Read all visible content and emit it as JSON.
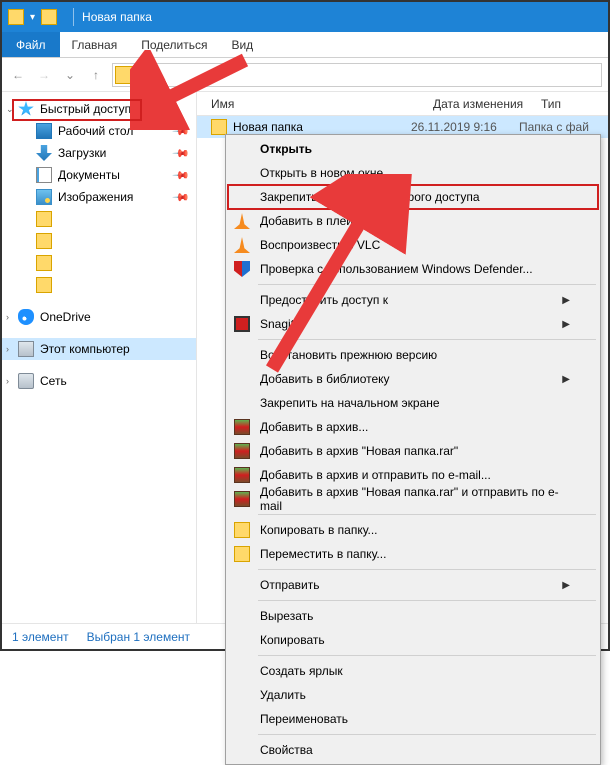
{
  "title": "Новая папка",
  "menubar": {
    "file": "Файл",
    "home": "Главная",
    "share": "Поделиться",
    "view": "Вид"
  },
  "breadcrumb": {
    "segments": []
  },
  "columns": {
    "name": "Имя",
    "date": "Дата изменения",
    "type": "Тип"
  },
  "sidebar": {
    "quick_access": "Быстрый доступ",
    "desktop": "Рабочий стол",
    "downloads": "Загрузки",
    "documents": "Документы",
    "pictures": "Изображения",
    "onedrive": "OneDrive",
    "this_pc": "Этот компьютер",
    "network": "Сеть"
  },
  "files": [
    {
      "name": "Новая папка",
      "date": "26.11.2019 9:16",
      "type": "Папка с фай"
    }
  ],
  "context_menu": {
    "open": "Открыть",
    "open_new": "Открыть в новом окне",
    "pin_quick": "Закрепить на панели быстрого доступа",
    "vlc_add": "Добавить в плейлист VLC",
    "vlc_play": "Воспроизвести в VLC",
    "defender": "Проверка с использованием Windows Defender...",
    "grant_access": "Предоставить доступ к",
    "snagit": "Snagit",
    "restore_prev": "Восстановить прежнюю версию",
    "add_library": "Добавить в библиотеку",
    "pin_start": "Закрепить на начальном экране",
    "rar_add": "Добавить в архив...",
    "rar_add_name": "Добавить в архив \"Новая папка.rar\"",
    "rar_email": "Добавить в архив и отправить по e-mail...",
    "rar_name_email": "Добавить в архив \"Новая папка.rar\" и отправить по e-mail",
    "copy_to": "Копировать в папку...",
    "move_to": "Переместить в папку...",
    "send_to": "Отправить",
    "cut": "Вырезать",
    "copy": "Копировать",
    "shortcut": "Создать ярлык",
    "delete": "Удалить",
    "rename": "Переименовать",
    "properties": "Свойства"
  },
  "status": {
    "count": "1 элемент",
    "selected": "Выбран 1 элемент"
  }
}
